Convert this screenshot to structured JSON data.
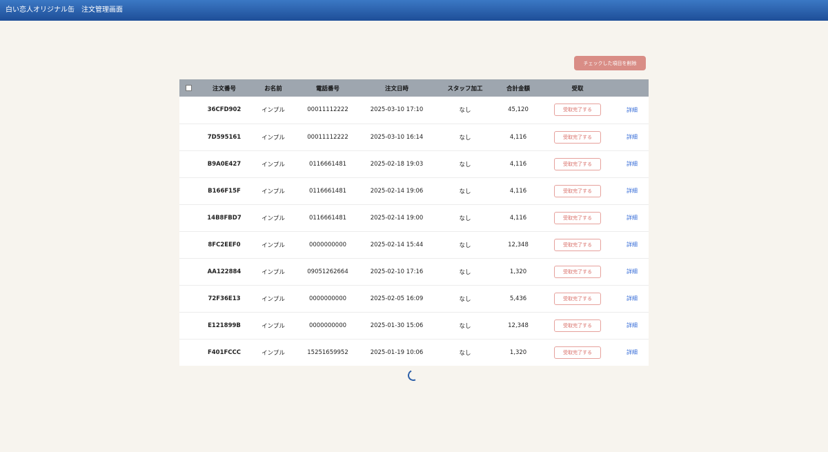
{
  "header": {
    "title": "白い恋人オリジナル缶　注文管理画面"
  },
  "toolbar": {
    "delete_label": "チェックした項目を削除"
  },
  "table": {
    "columns": [
      "注文番号",
      "お名前",
      "電話番号",
      "注文日時",
      "スタッフ加工",
      "合計金額",
      "受取"
    ],
    "receive_label": "受取完了する",
    "detail_label": "詳細",
    "rows": [
      {
        "order_no": "36CFD902",
        "name": "インプル",
        "phone": "00011112222",
        "datetime": "2025-03-10 17:10",
        "staff": "なし",
        "total": "45,120"
      },
      {
        "order_no": "7D595161",
        "name": "インプル",
        "phone": "00011112222",
        "datetime": "2025-03-10 16:14",
        "staff": "なし",
        "total": "4,116"
      },
      {
        "order_no": "B9A0E427",
        "name": "インプル",
        "phone": "0116661481",
        "datetime": "2025-02-18 19:03",
        "staff": "なし",
        "total": "4,116"
      },
      {
        "order_no": "B166F15F",
        "name": "インプル",
        "phone": "0116661481",
        "datetime": "2025-02-14 19:06",
        "staff": "なし",
        "total": "4,116"
      },
      {
        "order_no": "14B8FBD7",
        "name": "インプル",
        "phone": "0116661481",
        "datetime": "2025-02-14 19:00",
        "staff": "なし",
        "total": "4,116"
      },
      {
        "order_no": "8FC2EEF0",
        "name": "インプル",
        "phone": "0000000000",
        "datetime": "2025-02-14 15:44",
        "staff": "なし",
        "total": "12,348"
      },
      {
        "order_no": "AA122884",
        "name": "インプル",
        "phone": "09051262664",
        "datetime": "2025-02-10 17:16",
        "staff": "なし",
        "total": "1,320"
      },
      {
        "order_no": "72F36E13",
        "name": "インプル",
        "phone": "0000000000",
        "datetime": "2025-02-05 16:09",
        "staff": "なし",
        "total": "5,436"
      },
      {
        "order_no": "E121899B",
        "name": "インプル",
        "phone": "0000000000",
        "datetime": "2025-01-30 15:06",
        "staff": "なし",
        "total": "12,348"
      },
      {
        "order_no": "F401FCCC",
        "name": "インプル",
        "phone": "15251659952",
        "datetime": "2025-01-19 10:06",
        "staff": "なし",
        "total": "1,320"
      }
    ]
  }
}
